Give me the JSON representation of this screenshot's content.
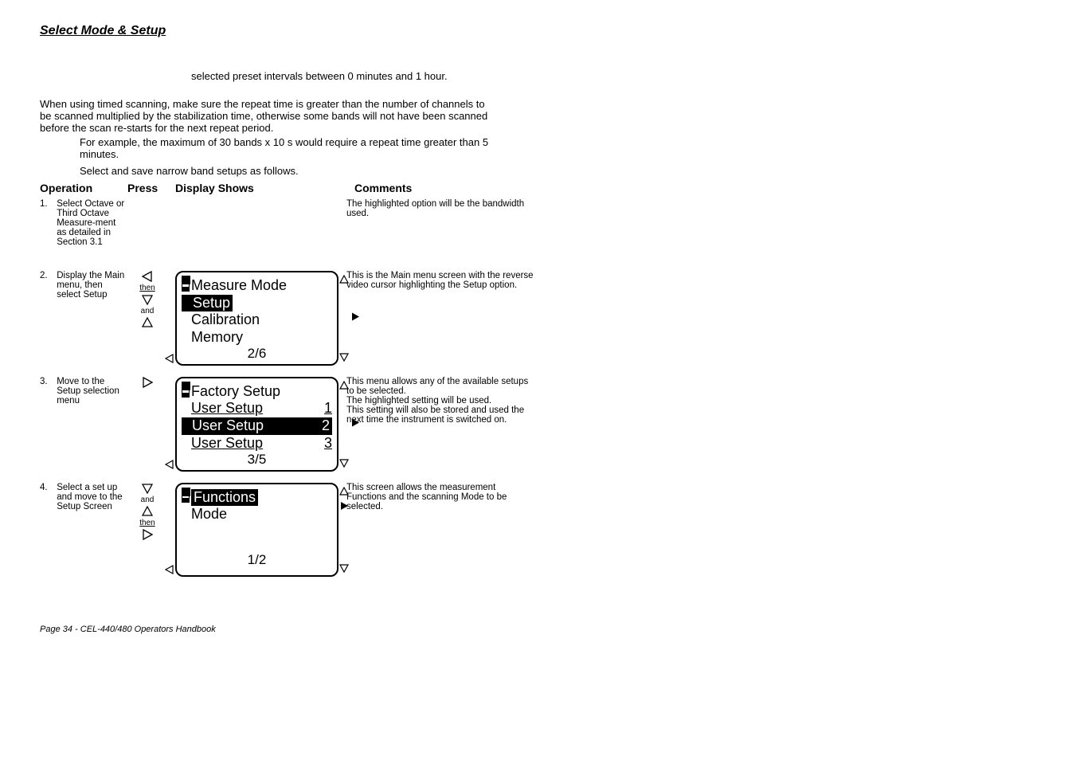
{
  "section_title": "Select Mode & Setup",
  "intro": {
    "preset": "selected preset intervals between 0 minutes and 1 hour.",
    "para1": "When using timed scanning, make sure the repeat time is greater than the number of channels to be scanned multiplied by the stabilization time, otherwise some bands will not have been scanned before the scan re-starts for the next repeat period.",
    "para2": "For example, the maximum of 30 bands x 10 s would require a repeat time greater than 5 minutes.",
    "para3": "Select and save narrow band setups as follows."
  },
  "headers": {
    "operation": "Operation",
    "press": "Press",
    "display": "Display Shows",
    "comments": "Comments"
  },
  "rows": [
    {
      "num": "1.",
      "op": "Select Octave or Third Octave Measure-ment as detailed in Section 3.1",
      "comment": "The highlighted option will be the bandwidth used."
    },
    {
      "num": "2.",
      "op": "Display the Main menu, then select Setup",
      "press": [
        "left",
        "then",
        "down",
        "and",
        "up"
      ],
      "comment": "This is the Main menu screen with the reverse video cursor highlighting the Setup option.",
      "lcd": {
        "lines": [
          {
            "text": "Measure Mode",
            "hl": false
          },
          {
            "text": "Setup",
            "hl": true
          },
          {
            "text": "Calibration",
            "hl": false
          },
          {
            "text": "Memory",
            "hl": false
          }
        ],
        "counter": "2/6"
      }
    },
    {
      "num": "3.",
      "op": "Move to the Setup selection menu",
      "press": [
        "right"
      ],
      "comment": "This menu allows any of the available setups to be selected.\nThe highlighted setting will be used.\nThis setting will also be stored and used the next time the instrument is switched on.",
      "lcd": {
        "lines": [
          {
            "text": "Factory Setup",
            "hl": false,
            "num": ""
          },
          {
            "text": "User Setup",
            "hl": false,
            "num": "1"
          },
          {
            "text": "User Setup",
            "hl": true,
            "num": "2"
          },
          {
            "text": "User Setup",
            "hl": false,
            "num": "3"
          }
        ],
        "counter": "3/5"
      }
    },
    {
      "num": "4.",
      "op": "Select a set up and move to the Setup Screen",
      "press": [
        "down",
        "and",
        "up",
        "then",
        "right"
      ],
      "comment": "This screen allows the measurement Functions and the scanning Mode to be selected.",
      "lcd": {
        "lines": [
          {
            "text": "Functions",
            "hl": true
          },
          {
            "text": "Mode",
            "hl": false
          }
        ],
        "counter": "1/2"
      }
    }
  ],
  "footer": "Page 34 - CEL-440/480 Operators Handbook",
  "icons": {
    "then": "then",
    "and": "and"
  }
}
